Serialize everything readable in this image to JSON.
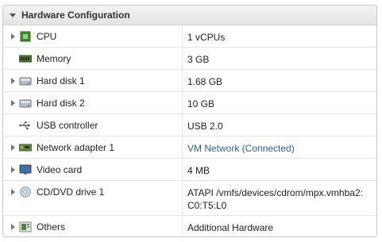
{
  "panel": {
    "title": "Hardware Configuration"
  },
  "rows": [
    {
      "label": "CPU",
      "value": "1 vCPUs",
      "icon": "cpu-icon",
      "expandable": true
    },
    {
      "label": "Memory",
      "value": "3 GB",
      "icon": "memory-icon",
      "expandable": false
    },
    {
      "label": "Hard disk 1",
      "value": "1.68 GB",
      "icon": "hard-disk-icon",
      "expandable": true
    },
    {
      "label": "Hard disk 2",
      "value": "10 GB",
      "icon": "hard-disk-icon",
      "expandable": true
    },
    {
      "label": "USB controller",
      "value": "USB 2.0",
      "icon": "usb-icon",
      "expandable": false
    },
    {
      "label": "Network adapter 1",
      "value": "VM Network (Connected)",
      "icon": "network-adapter-icon",
      "expandable": true
    },
    {
      "label": "Video card",
      "value": "4 MB",
      "icon": "monitor-icon",
      "expandable": true
    },
    {
      "label": "CD/DVD drive 1",
      "value_line1": "ATAPI /vmfs/devices/cdrom/mpx.vmhba2:",
      "value_line2": "C0:T5:L0",
      "icon": "cd-dvd-icon",
      "expandable": true
    },
    {
      "label": "Others",
      "value": "Additional Hardware",
      "icon": "others-icon",
      "expandable": true
    }
  ],
  "colors": {
    "link": "#2e5f96",
    "border": "#c9c9c9"
  }
}
